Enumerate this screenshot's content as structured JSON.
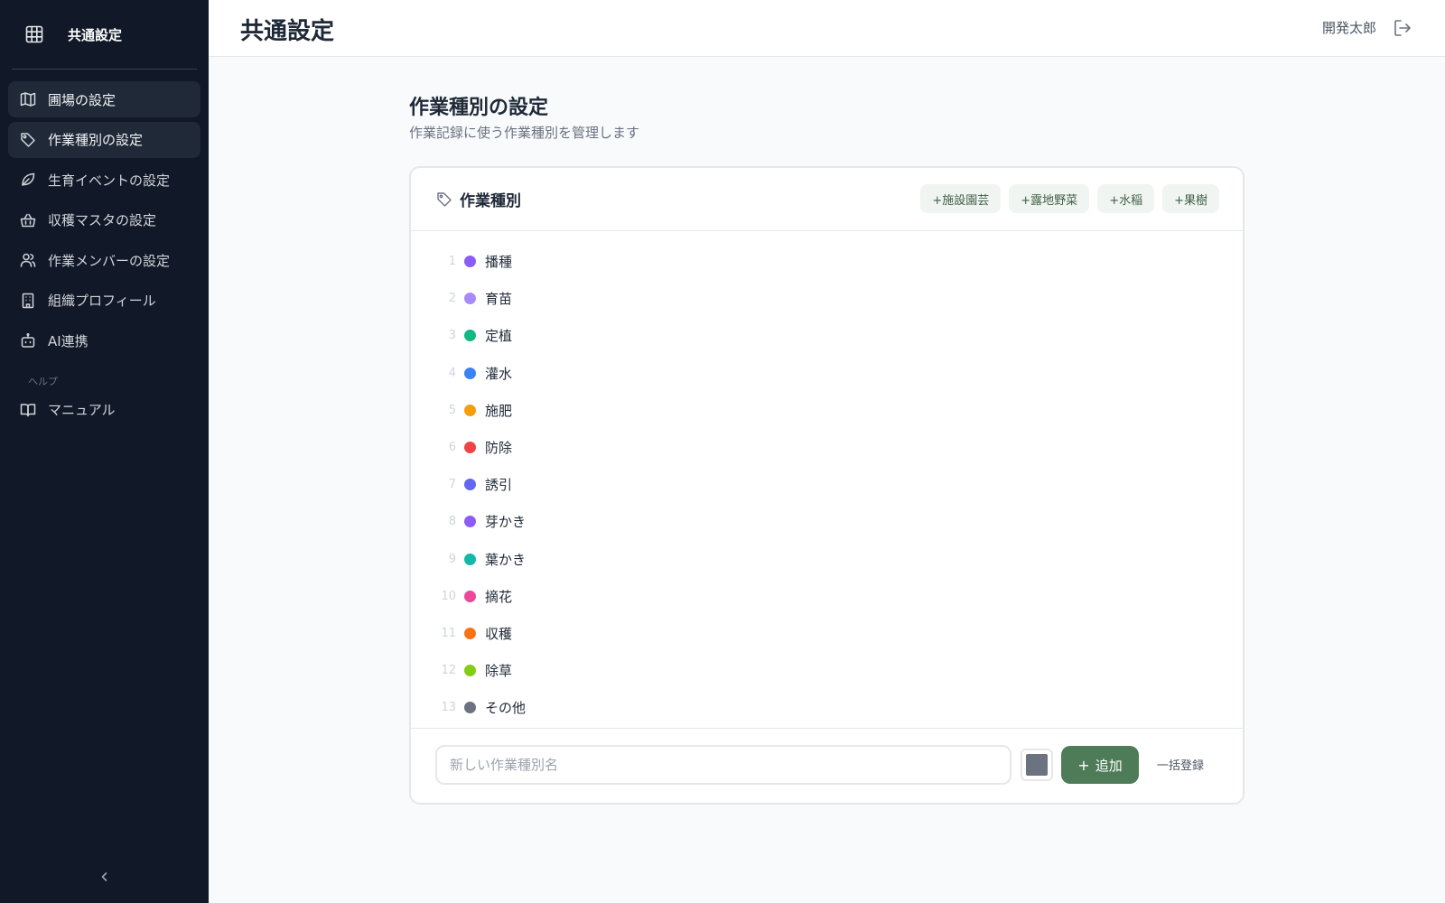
{
  "sidebar": {
    "title": "共通設定",
    "logo_icon": "grid-icon",
    "items": [
      {
        "label": "圃場の設定",
        "icon": "map-icon",
        "active": true
      },
      {
        "label": "作業種別の設定",
        "icon": "tag-icon",
        "active": true
      },
      {
        "label": "生育イベントの設定",
        "icon": "leaf-icon",
        "active": false
      },
      {
        "label": "収穫マスタの設定",
        "icon": "basket-icon",
        "active": false
      },
      {
        "label": "作業メンバーの設定",
        "icon": "users-icon",
        "active": false
      },
      {
        "label": "組織プロフィール",
        "icon": "building-icon",
        "active": false
      },
      {
        "label": "AI連携",
        "icon": "bot-icon",
        "active": false
      }
    ],
    "help_section": "ヘルプ",
    "help_items": [
      {
        "label": "マニュアル",
        "icon": "book-icon"
      }
    ],
    "collapse_icon": "chevron-left-icon"
  },
  "topbar": {
    "title": "共通設定",
    "user_name": "開発太郎",
    "logout_icon": "logout-icon"
  },
  "main": {
    "heading": "作業種別の設定",
    "subheading": "作業記録に使う作業種別を管理します"
  },
  "card": {
    "title": "作業種別",
    "title_icon": "tag-icon",
    "presets": [
      "+施設園芸",
      "+露地野菜",
      "+水稲",
      "+果樹"
    ],
    "work_types": [
      {
        "num": "1",
        "name": "播種",
        "color": "#8b5cf6"
      },
      {
        "num": "2",
        "name": "育苗",
        "color": "#a78bfa"
      },
      {
        "num": "3",
        "name": "定植",
        "color": "#10b981"
      },
      {
        "num": "4",
        "name": "灌水",
        "color": "#3b82f6"
      },
      {
        "num": "5",
        "name": "施肥",
        "color": "#f59e0b"
      },
      {
        "num": "6",
        "name": "防除",
        "color": "#ef4444"
      },
      {
        "num": "7",
        "name": "誘引",
        "color": "#6366f1"
      },
      {
        "num": "8",
        "name": "芽かき",
        "color": "#8b5cf6"
      },
      {
        "num": "9",
        "name": "葉かき",
        "color": "#14b8a6"
      },
      {
        "num": "10",
        "name": "摘花",
        "color": "#ec4899"
      },
      {
        "num": "11",
        "name": "収穫",
        "color": "#f97316"
      },
      {
        "num": "12",
        "name": "除草",
        "color": "#84cc16"
      },
      {
        "num": "13",
        "name": "その他",
        "color": "#6b7280"
      }
    ],
    "new_input": {
      "placeholder": "新しい作業種別名",
      "value": ""
    },
    "new_color": "#6b7280",
    "add_button": "追加",
    "bulk_button": "一括登録"
  },
  "colors": {
    "sidebar_bg": "#111827",
    "accent": "#4e7c59"
  }
}
